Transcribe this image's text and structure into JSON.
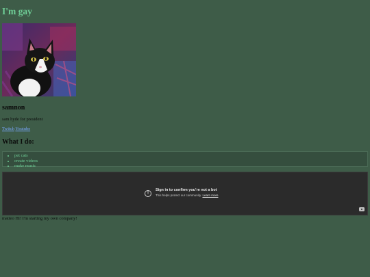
{
  "header": {
    "title": "I'm gay"
  },
  "profile": {
    "avatar_icon": "cat-photo",
    "username": "samnon",
    "bio": "sam hyde for president",
    "links": [
      {
        "label": "Twitch"
      },
      {
        "label": "Youtube"
      }
    ]
  },
  "activities": {
    "heading": "What I do:",
    "items": [
      "pet cats",
      "create videos",
      "make music"
    ]
  },
  "video_embed": {
    "title": "Sign in to confirm you’re not a bot",
    "subtitle": "This helps protect our community.",
    "learn_more": "Learn more",
    "icon": "info-icon",
    "logo_icon": "youtube-icon"
  },
  "footer": {
    "note": "matteo Hi! I'm starting my own company!"
  },
  "colors": {
    "background": "#3e5c48",
    "title": "#6fcf97",
    "link": "#7aa8ff",
    "video_bg": "#2b2b2b"
  }
}
